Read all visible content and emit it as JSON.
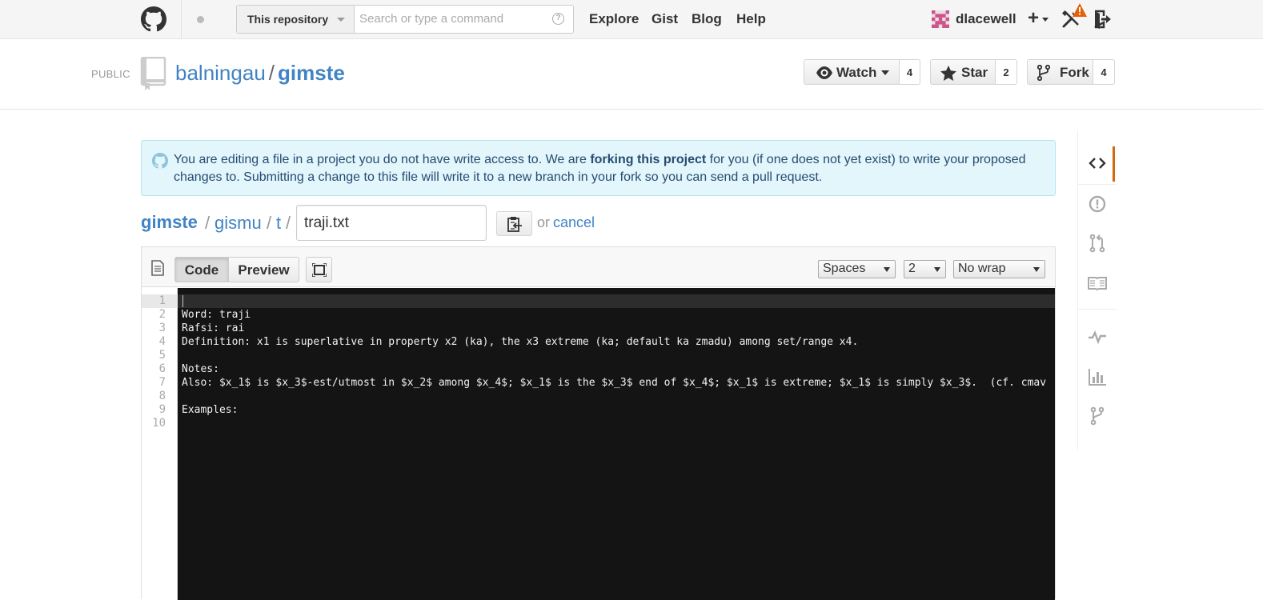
{
  "header": {
    "search_scope": "This repository",
    "search_placeholder": "Search or type a command",
    "search_help": "?",
    "nav": [
      "Explore",
      "Gist",
      "Blog",
      "Help"
    ],
    "username": "dlacewell",
    "plus": "+"
  },
  "repo": {
    "visibility": "PUBLIC",
    "owner": "balningau",
    "separator": "/",
    "name": "gimste",
    "watch_label": "Watch",
    "watch_count": "4",
    "star_label": "Star",
    "star_count": "2",
    "fork_label": "Fork",
    "fork_count": "4"
  },
  "flash": {
    "text_before": "You are editing a file in a project you do not have write access to. We are ",
    "bold": "forking this project",
    "text_after": " for you (if one does not yet exist) to write your proposed changes to. Submitting a change to this file will write it to a new branch in your fork so you can send a pull request."
  },
  "breadcrumb": {
    "root": "gimste",
    "parts": [
      "gismu",
      "t"
    ],
    "separator": "/",
    "filename": "traji.txt",
    "or": "or",
    "cancel": "cancel"
  },
  "editor": {
    "tabs": [
      "Code",
      "Preview"
    ],
    "indent_mode": "Spaces",
    "indent_size": "2",
    "wrap_mode": "No wrap",
    "line_numbers": [
      "1",
      "2",
      "3",
      "4",
      "5",
      "6",
      "7",
      "8",
      "9",
      "10"
    ],
    "lines": [
      "",
      "Word: traji",
      "Rafsi: rai",
      "Definition: x1 is superlative in property x2 (ka), the x3 extreme (ka; default ka zmadu) among set/range x4.",
      "",
      "Notes:",
      "Also: $x_1$ is $x_3$-est/utmost in $x_2$ among $x_4$; $x_1$ is the $x_3$ end of $x_4$; $x_1$ is extreme; $x_1$ is simply $x_3$.  (cf. cmav",
      "",
      "Examples:",
      ""
    ]
  },
  "colors": {
    "link": "#4183c4",
    "flash_bg": "#e2f6fb",
    "editor_bg": "#141414",
    "active_tab_bar": "#d26911",
    "warning": "#e36209"
  }
}
